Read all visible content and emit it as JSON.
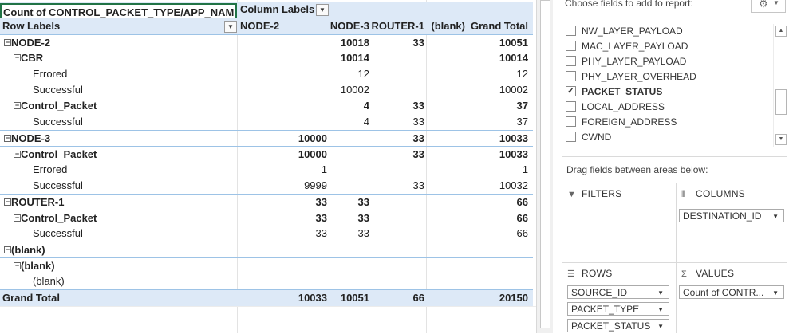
{
  "pivot": {
    "corner_label": "Count of CONTROL_PACKET_TYPE/APP_NAME",
    "column_labels": "Column Labels",
    "row_labels": "Row Labels",
    "columns": [
      "NODE-2",
      "NODE-3",
      "ROUTER-1",
      "(blank)",
      "Grand Total"
    ],
    "rows": [
      {
        "label": "NODE-2",
        "level": 0,
        "toggle": "⊟",
        "bold": true,
        "vals": [
          "",
          "10018",
          "33",
          "",
          "10051"
        ]
      },
      {
        "label": "CBR",
        "level": 1,
        "toggle": "⊟",
        "bold": true,
        "vals": [
          "",
          "10014",
          "",
          "",
          "10014"
        ]
      },
      {
        "label": "Errored",
        "level": 2,
        "toggle": "",
        "bold": false,
        "vals": [
          "",
          "12",
          "",
          "",
          "12"
        ]
      },
      {
        "label": "Successful",
        "level": 2,
        "toggle": "",
        "bold": false,
        "vals": [
          "",
          "10002",
          "",
          "",
          "10002"
        ]
      },
      {
        "label": "Control_Packet",
        "level": 1,
        "toggle": "⊟",
        "bold": true,
        "vals": [
          "",
          "4",
          "33",
          "",
          "37"
        ]
      },
      {
        "label": "Successful",
        "level": 2,
        "toggle": "",
        "bold": false,
        "vals": [
          "",
          "4",
          "33",
          "",
          "37"
        ]
      },
      {
        "label": "NODE-3",
        "level": 0,
        "toggle": "⊟",
        "bold": true,
        "vals": [
          "10000",
          "",
          "33",
          "",
          "10033"
        ]
      },
      {
        "label": "Control_Packet",
        "level": 1,
        "toggle": "⊟",
        "bold": true,
        "vals": [
          "10000",
          "",
          "33",
          "",
          "10033"
        ]
      },
      {
        "label": "Errored",
        "level": 2,
        "toggle": "",
        "bold": false,
        "vals": [
          "1",
          "",
          "",
          "",
          "1"
        ]
      },
      {
        "label": "Successful",
        "level": 2,
        "toggle": "",
        "bold": false,
        "vals": [
          "9999",
          "",
          "33",
          "",
          "10032"
        ]
      },
      {
        "label": "ROUTER-1",
        "level": 0,
        "toggle": "⊟",
        "bold": true,
        "vals": [
          "33",
          "33",
          "",
          "",
          "66"
        ]
      },
      {
        "label": "Control_Packet",
        "level": 1,
        "toggle": "⊟",
        "bold": true,
        "vals": [
          "33",
          "33",
          "",
          "",
          "66"
        ]
      },
      {
        "label": "Successful",
        "level": 2,
        "toggle": "",
        "bold": false,
        "vals": [
          "33",
          "33",
          "",
          "",
          "66"
        ]
      },
      {
        "label": "(blank)",
        "level": 0,
        "toggle": "⊟",
        "bold": true,
        "vals": [
          "",
          "",
          "",
          "",
          ""
        ]
      },
      {
        "label": "(blank)",
        "level": 1,
        "toggle": "⊟",
        "bold": true,
        "vals": [
          "",
          "",
          "",
          "",
          ""
        ]
      },
      {
        "label": "(blank)",
        "level": 2,
        "toggle": "",
        "bold": false,
        "vals": [
          "",
          "",
          "",
          "",
          ""
        ]
      }
    ],
    "grand_total": {
      "label": "Grand Total",
      "vals": [
        "10033",
        "10051",
        "66",
        "",
        "20150"
      ]
    }
  },
  "pane": {
    "title": "Choose fields to add to report:",
    "gear_icon": "gear-icon",
    "fields": [
      {
        "name": "NW_LAYER_PAYLOAD",
        "checked": false
      },
      {
        "name": "MAC_LAYER_PAYLOAD",
        "checked": false
      },
      {
        "name": "PHY_LAYER_PAYLOAD",
        "checked": false
      },
      {
        "name": "PHY_LAYER_OVERHEAD",
        "checked": false
      },
      {
        "name": "PACKET_STATUS",
        "checked": true
      },
      {
        "name": "LOCAL_ADDRESS",
        "checked": false
      },
      {
        "name": "FOREIGN_ADDRESS",
        "checked": false
      },
      {
        "name": "CWND",
        "checked": false
      }
    ],
    "drag_title": "Drag fields between areas below:",
    "areas": {
      "filters": {
        "label": "FILTERS",
        "icon": "filter-icon",
        "chips": []
      },
      "columns": {
        "label": "COLUMNS",
        "icon": "columns-icon",
        "chips": [
          "DESTINATION_ID"
        ]
      },
      "rows": {
        "label": "ROWS",
        "icon": "rows-icon",
        "chips": [
          "SOURCE_ID",
          "PACKET_TYPE",
          "PACKET_STATUS"
        ]
      },
      "values": {
        "label": "VALUES",
        "icon": "sigma-icon",
        "chips": [
          "Count of CONTR..."
        ]
      }
    }
  }
}
